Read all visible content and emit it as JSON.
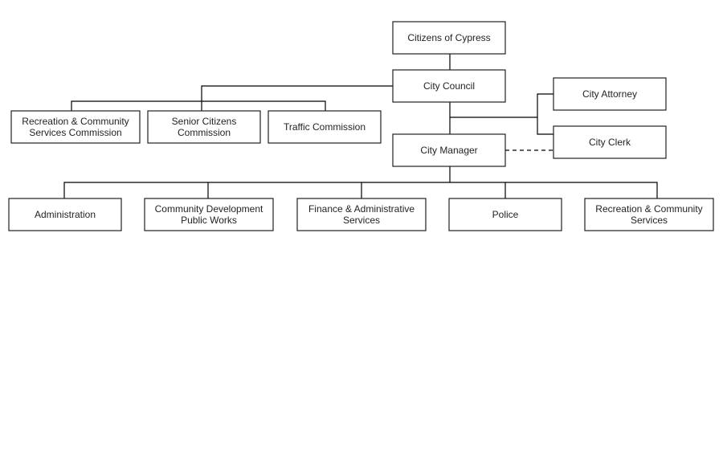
{
  "nodes": {
    "citizens": {
      "lines": [
        "Citizens of Cypress"
      ]
    },
    "council": {
      "lines": [
        "City Council"
      ]
    },
    "attorney": {
      "lines": [
        "City Attorney"
      ]
    },
    "clerk": {
      "lines": [
        "City Clerk"
      ]
    },
    "manager": {
      "lines": [
        "City Manager"
      ]
    },
    "rec_commission": {
      "lines": [
        "Recreation & Community",
        "Services Commission"
      ]
    },
    "senior_commission": {
      "lines": [
        "Senior Citizens",
        "Commission"
      ]
    },
    "traffic_commission": {
      "lines": [
        "Traffic Commission"
      ]
    },
    "administration": {
      "lines": [
        "Administration"
      ]
    },
    "community_dev": {
      "lines": [
        "Community Development",
        "Public Works"
      ]
    },
    "finance": {
      "lines": [
        "Finance & Administrative",
        "Services"
      ]
    },
    "police": {
      "lines": [
        "Police"
      ]
    },
    "rec_services": {
      "lines": [
        "Recreation & Community",
        "Services"
      ]
    }
  },
  "edges": [
    {
      "from": "citizens",
      "to": "council",
      "style": "solid"
    },
    {
      "from": "council",
      "to": "rec_commission",
      "style": "solid"
    },
    {
      "from": "council",
      "to": "senior_commission",
      "style": "solid"
    },
    {
      "from": "council",
      "to": "traffic_commission",
      "style": "solid"
    },
    {
      "from": "council",
      "to": "manager",
      "style": "solid"
    },
    {
      "from": "council",
      "to": "attorney",
      "style": "solid"
    },
    {
      "from": "council",
      "to": "clerk",
      "style": "solid"
    },
    {
      "from": "manager",
      "to": "clerk",
      "style": "dashed"
    },
    {
      "from": "manager",
      "to": "administration",
      "style": "solid"
    },
    {
      "from": "manager",
      "to": "community_dev",
      "style": "solid"
    },
    {
      "from": "manager",
      "to": "finance",
      "style": "solid"
    },
    {
      "from": "manager",
      "to": "police",
      "style": "solid"
    },
    {
      "from": "manager",
      "to": "rec_services",
      "style": "solid"
    }
  ]
}
